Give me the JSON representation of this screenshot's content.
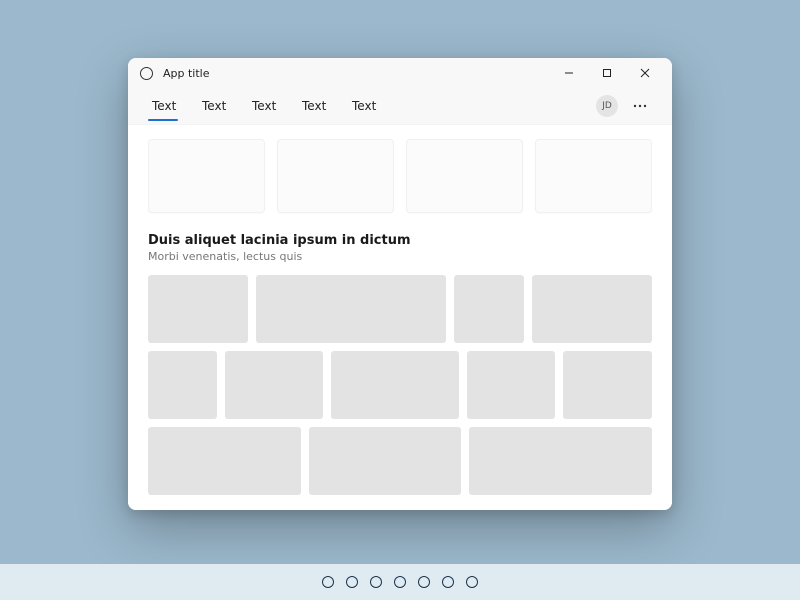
{
  "window": {
    "title": "App title",
    "avatar_initials": "JD"
  },
  "tabs": [
    {
      "label": "Text",
      "active": true
    },
    {
      "label": "Text",
      "active": false
    },
    {
      "label": "Text",
      "active": false
    },
    {
      "label": "Text",
      "active": false
    },
    {
      "label": "Text",
      "active": false
    }
  ],
  "cards_count": 4,
  "section": {
    "title": "Duis aliquet lacinia ipsum in dictum",
    "subtitle": "Morbi venenatis, lectus quis"
  },
  "masonry_rows": [
    [
      100,
      190,
      70,
      120
    ],
    [
      70,
      100,
      130,
      90,
      90
    ],
    [
      150,
      150,
      180
    ]
  ],
  "taskbar_dots": 7
}
